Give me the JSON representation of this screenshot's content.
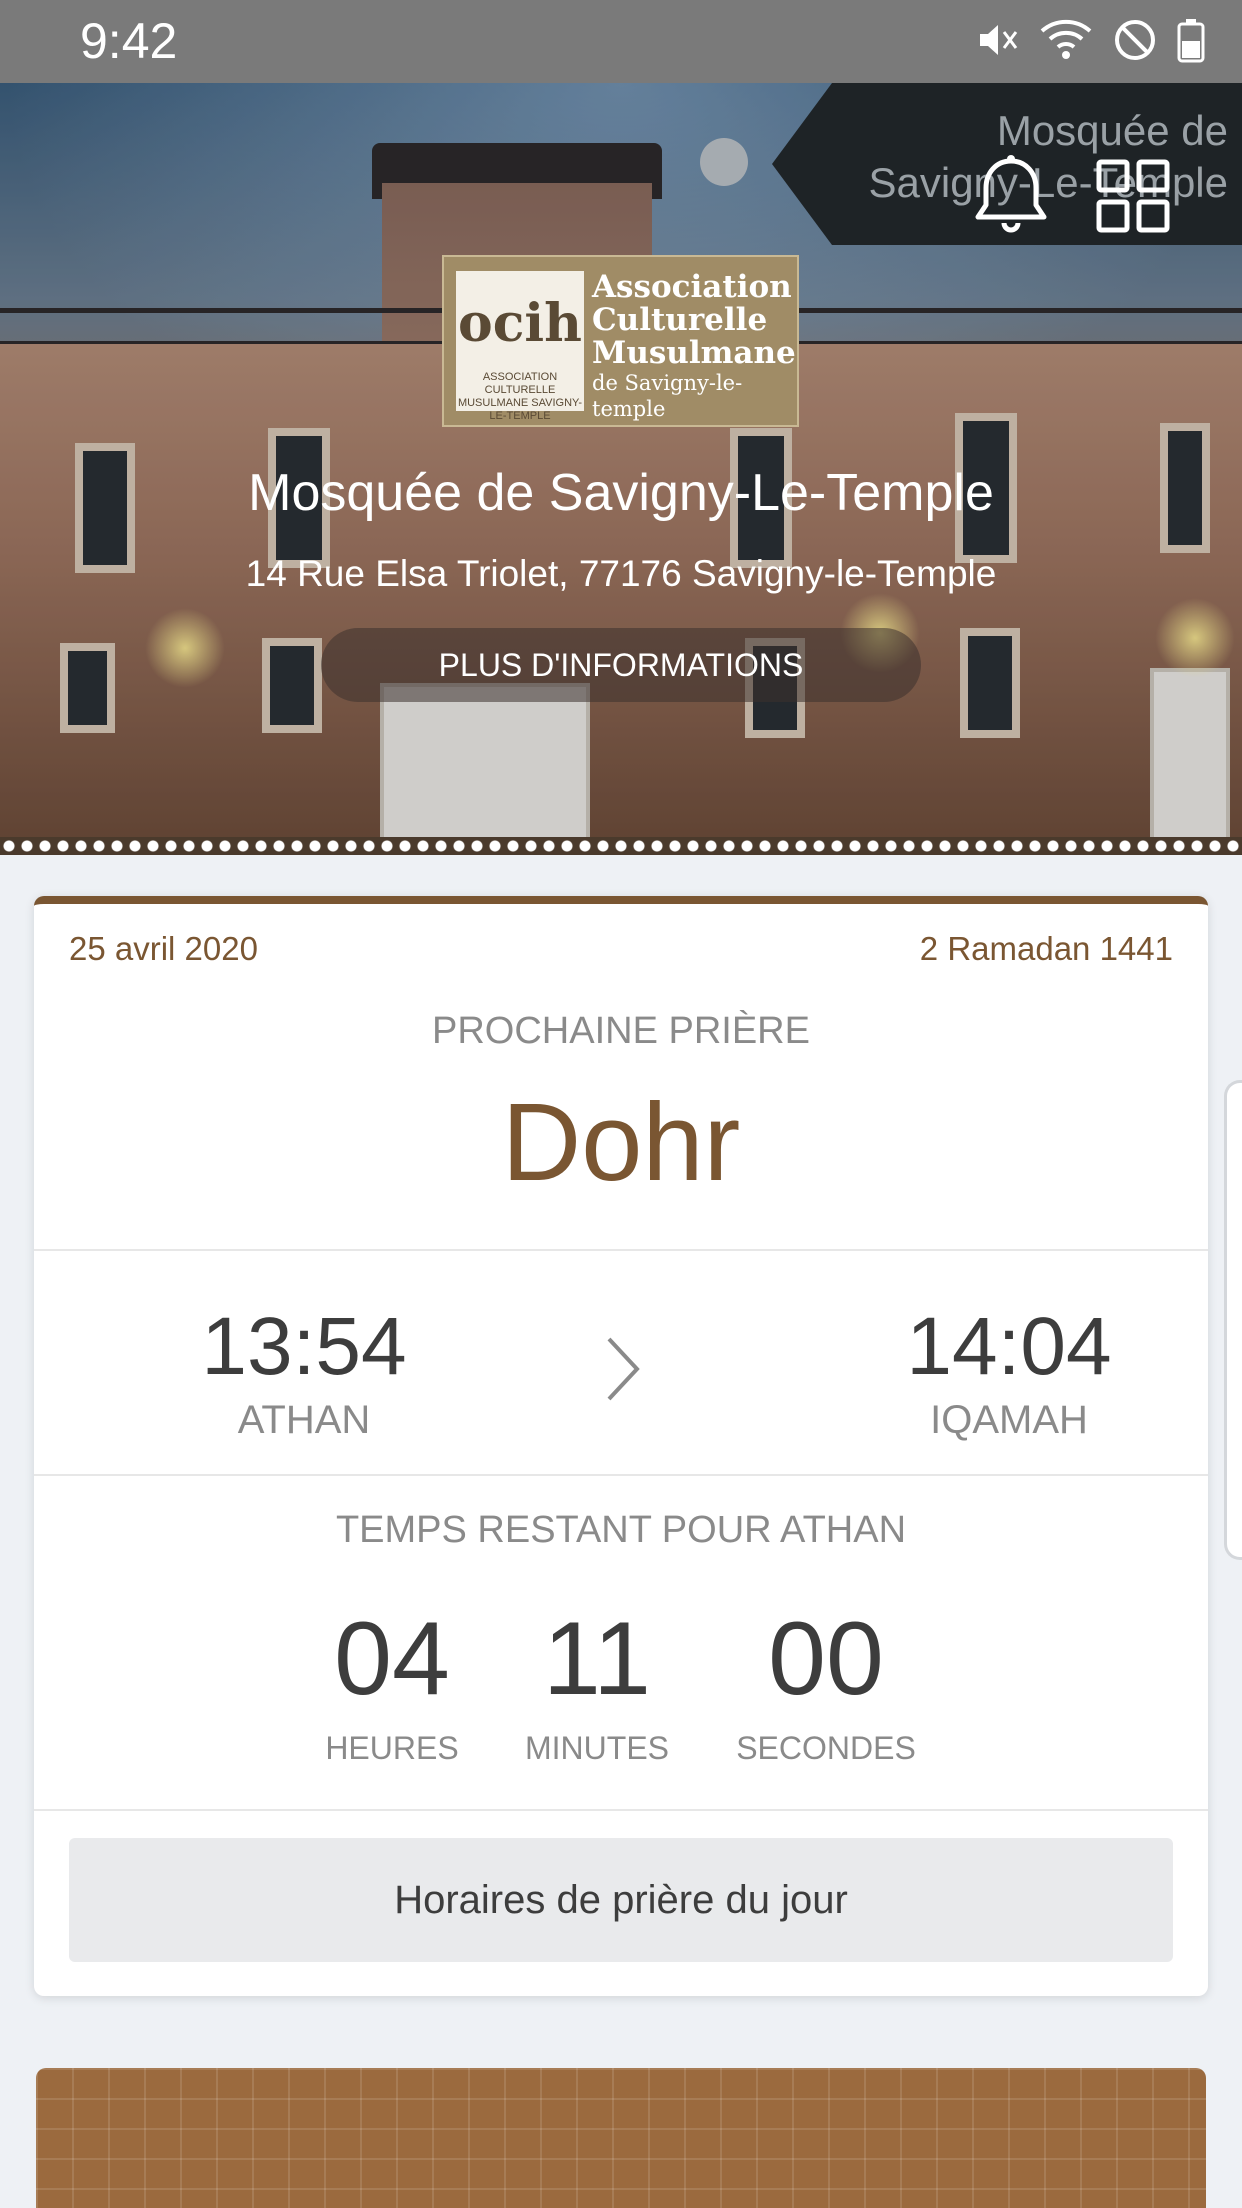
{
  "status_bar": {
    "time": "9:42",
    "icons": [
      "mute-icon",
      "wifi-icon",
      "do-not-disturb-icon",
      "battery-icon"
    ]
  },
  "hero": {
    "mosque_tag": "Mosquée de Savigny-Le-Temple",
    "logo": {
      "mark": "ocih",
      "mark_sub": "ASSOCIATION CULTURELLE MUSULMANE SAVIGNY-LE-TEMPLE",
      "line1": "Association",
      "line2": "Culturelle",
      "line3": "Musulmane",
      "line4": "de Savigny-le-temple"
    },
    "title": "Mosquée de Savigny-Le-Temple",
    "address": "14 Rue Elsa Triolet, 77176 Savigny-le-Temple",
    "more_info": "PLUS D'INFORMATIONS"
  },
  "prayer_card": {
    "date_gregorian": "25 avril 2020",
    "date_hijri": "2 Ramadan 1441",
    "next_label": "PROCHAINE PRIÈRE",
    "next_name": "Dohr",
    "athan_time": "13:54",
    "athan_label": "ATHAN",
    "iqamah_time": "14:04",
    "iqamah_label": "IQAMAH",
    "remaining_label": "TEMPS RESTANT POUR ATHAN",
    "hours": "04",
    "hours_label": "HEURES",
    "minutes": "11",
    "minutes_label": "MINUTES",
    "seconds": "00",
    "seconds_label": "SECONDES",
    "day_button": "Horaires de prière du jour"
  },
  "colors": {
    "accent": "#7a5632",
    "status_bar": "#7a7a7a",
    "background": "#eef1f5"
  }
}
